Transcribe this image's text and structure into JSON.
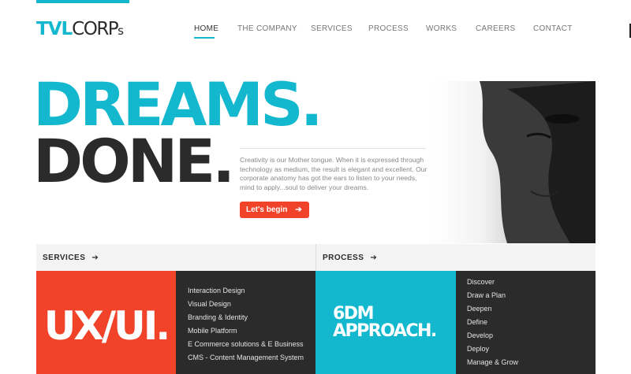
{
  "brand": {
    "part_a": "TVL",
    "part_b": "CORP",
    "part_c": "s"
  },
  "nav": {
    "items": [
      {
        "label": "HOME",
        "active": true
      },
      {
        "label": "THE COMPANY",
        "active": false
      },
      {
        "label": "SERVICES",
        "active": false
      },
      {
        "label": "PROCESS",
        "active": false
      },
      {
        "label": "WORKS",
        "active": false
      },
      {
        "label": "CAREERS",
        "active": false
      },
      {
        "label": "CONTACT",
        "active": false
      }
    ]
  },
  "hero": {
    "headline_1": "DREAMS.",
    "headline_2": "DONE.",
    "body": "Creativity is our Mother tongue. When it is expressed through technology as medium, the result is elegant and excellent. Our corporate anatomy has got the ears to listen to your needs, mind to apply...soul to deliver your dreams.",
    "cta": "Let's begin",
    "cta_icon": "arrow-right-icon"
  },
  "services": {
    "title": "SERVICES",
    "tile": "UX/UI.",
    "items": [
      "Interaction Design",
      "Visual Design",
      "Branding & Identity",
      "Mobile Platform",
      "E Commerce solutions & E Business",
      "CMS - Content Management System"
    ]
  },
  "process": {
    "title": "PROCESS",
    "tile_line_1": "6DM",
    "tile_line_2": "APPROACH.",
    "items": [
      "Discover",
      "Draw a Plan",
      "Deepen",
      "Define",
      "Develop",
      "Deploy",
      "Manage & Grow"
    ]
  },
  "colors": {
    "accent": "#13b8cf",
    "cta": "#f0432a",
    "dark": "#2b2b2b",
    "light_bar": "#f3f3f3"
  }
}
